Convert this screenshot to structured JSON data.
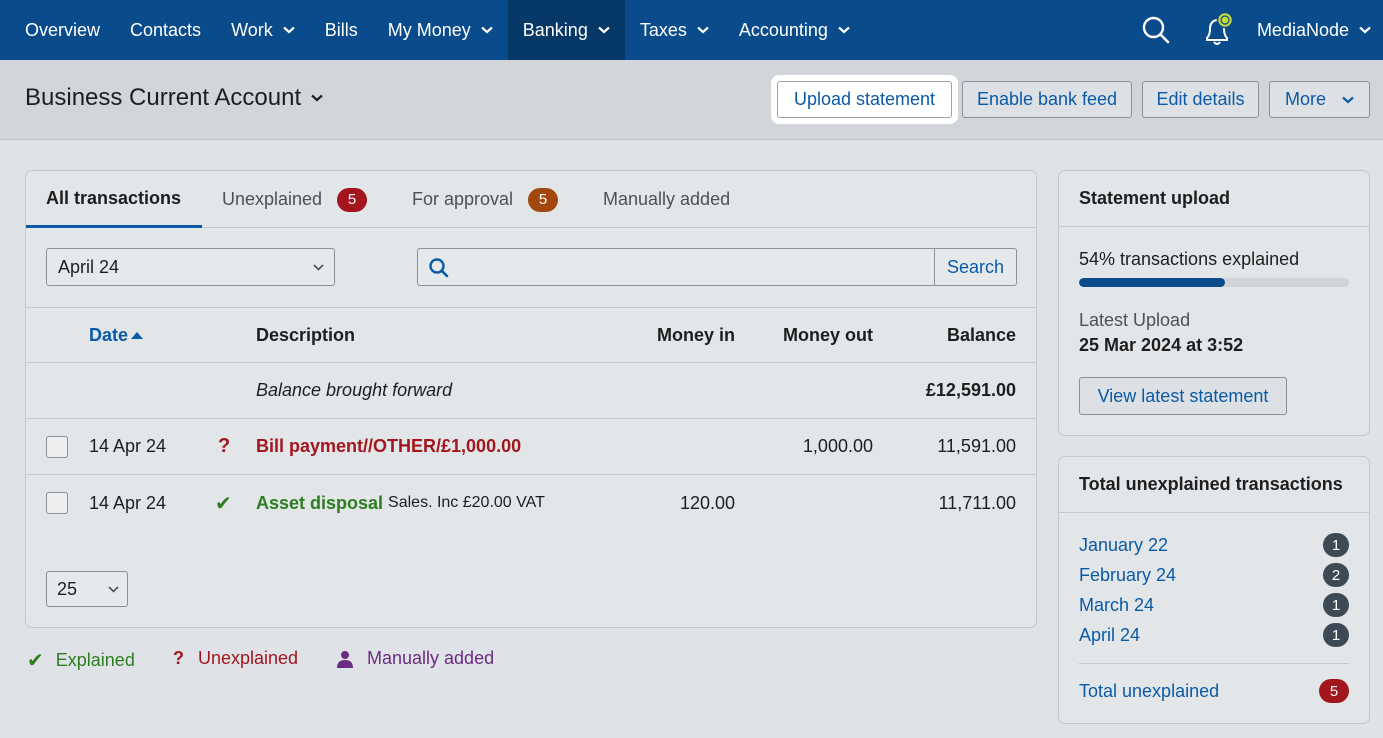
{
  "nav": {
    "items": [
      {
        "label": "Overview",
        "has_menu": false
      },
      {
        "label": "Contacts",
        "has_menu": false
      },
      {
        "label": "Work",
        "has_menu": true
      },
      {
        "label": "Bills",
        "has_menu": false
      },
      {
        "label": "My Money",
        "has_menu": true
      },
      {
        "label": "Banking",
        "has_menu": true,
        "active": true
      },
      {
        "label": "Taxes",
        "has_menu": true
      },
      {
        "label": "Accounting",
        "has_menu": true
      }
    ],
    "user": "MediaNode",
    "icons": [
      "search-icon",
      "bell-icon",
      "chevron-down-icon"
    ]
  },
  "header": {
    "title": "Business Current Account",
    "upload_label": "Upload statement",
    "bank_feed_label": "Enable bank feed",
    "edit_label": "Edit details",
    "more_label": "More"
  },
  "tabs": {
    "all": "All transactions",
    "unexplained": "Unexplained",
    "unexplained_count": "5",
    "approval": "For approval",
    "approval_count": "5",
    "manual": "Manually added"
  },
  "filters": {
    "month": "April 24",
    "search_placeholder": "",
    "search_button": "Search",
    "page_size": "25"
  },
  "table": {
    "columns": {
      "date": "Date",
      "description": "Description",
      "money_in": "Money in",
      "money_out": "Money out",
      "balance": "Balance"
    },
    "brought_forward": {
      "label": "Balance brought forward",
      "balance": "£12,591.00"
    },
    "rows": [
      {
        "date": "14 Apr 24",
        "status": "unexplained",
        "status_glyph": "?",
        "description": "Bill payment//OTHER/£1,000.00",
        "detail": "",
        "money_in": "",
        "money_out": "1,000.00",
        "balance": "11,591.00"
      },
      {
        "date": "14 Apr 24",
        "status": "explained",
        "status_glyph": "✔",
        "description": "Asset disposal",
        "detail": "Sales. Inc £20.00 VAT",
        "money_in": "120.00",
        "money_out": "",
        "balance": "11,711.00"
      }
    ]
  },
  "legend": {
    "explained": "Explained",
    "unexplained": "Unexplained",
    "manual": "Manually added"
  },
  "statement_upload": {
    "title": "Statement upload",
    "progress_label": "54% transactions explained",
    "progress_value": 0.54,
    "latest_label": "Latest Upload",
    "latest_value": "25 Mar 2024 at 3:52",
    "view_button": "View latest statement"
  },
  "unexplained_totals": {
    "title": "Total unexplained transactions",
    "months": [
      {
        "label": "January 22",
        "count": "1"
      },
      {
        "label": "February 24",
        "count": "2"
      },
      {
        "label": "March 24",
        "count": "1"
      },
      {
        "label": "April 24",
        "count": "1"
      }
    ],
    "total_label": "Total unexplained",
    "total_count": "5"
  },
  "colors": {
    "nav_bg": "#0a4c8b",
    "nav_active": "#063868",
    "link": "#0a5aa6",
    "unexplained_red": "#a3161e",
    "explained_green": "#2e7d20",
    "manual_purple": "#6a2c82",
    "approval_orange": "#a3480c"
  }
}
